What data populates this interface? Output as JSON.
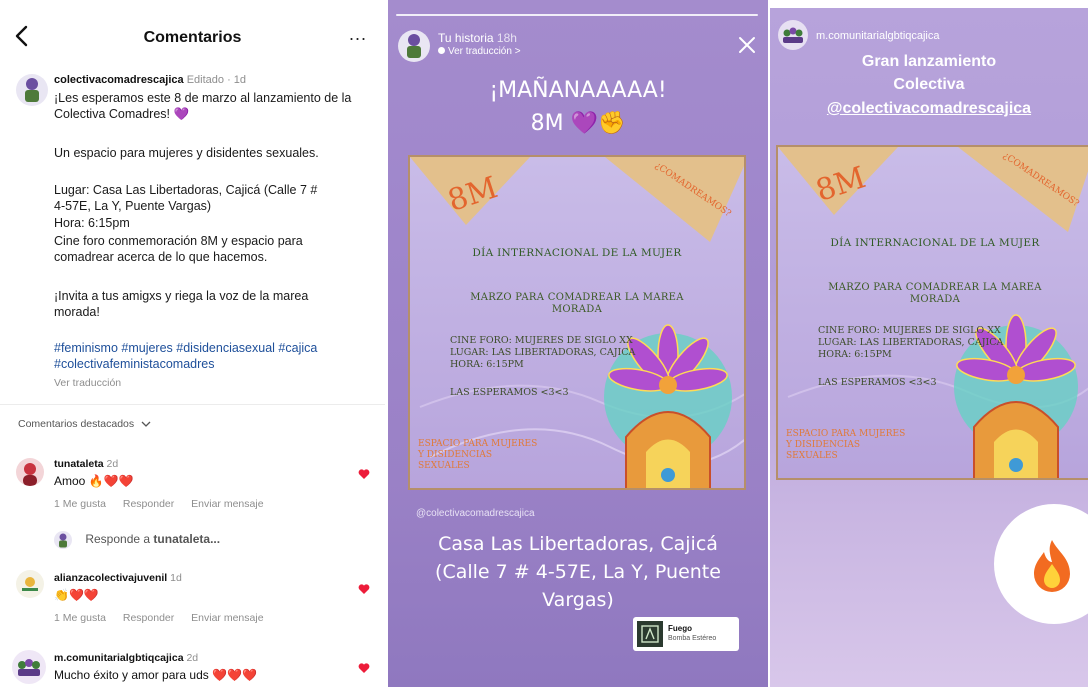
{
  "comments_panel": {
    "title": "Comentarios",
    "more": "...",
    "post": {
      "username": "colectivacomadrescajica",
      "meta": "Editado · 1d",
      "lines": [
        "¡Les esperamos este 8 de marzo al lanzamiento de la",
        "Colectiva Comadres! 💜",
        "Un espacio para mujeres y disidentes sexuales.",
        "Lugar: Casa Las Libertadoras, Cajicá (Calle 7 #",
        "4-57E, La Y, Puente Vargas)",
        "Hora: 6:15pm",
        "Cine foro conmemoración 8M y espacio para",
        "comadrear acerca de lo que hacemos.",
        "¡Invita a tus amigxs y riega la voz de la marea",
        "morada!"
      ],
      "hashtags_1": "#feminismo #mujeres #disidenciasexual #cajica",
      "hashtags_2": "#colectivafeministacomadres",
      "see_translation": "Ver traducción"
    },
    "featured_label": "Comentarios destacados",
    "comments": [
      {
        "username": "tunataleta",
        "meta": "2d",
        "text": "Amoo 🔥❤️❤️",
        "likes": "1 Me gusta",
        "reply": "Responder",
        "message": "Enviar mensaje"
      },
      {
        "username": "alianzacolectivajuvenil",
        "meta": "1d",
        "text": "👏❤️❤️",
        "likes": "1 Me gusta",
        "reply": "Responder",
        "message": "Enviar mensaje"
      },
      {
        "username": "m.comunitarialgbtiqcajica",
        "meta": "2d",
        "text": "Mucho éxito y amor para uds ❤️❤️❤️"
      }
    ],
    "reply_prompt_prefix": "Responde a ",
    "reply_prompt_user": "tunataleta...",
    "colors": {
      "heart": "#ed1c3a",
      "hashtag": "#1e4f9a",
      "meta": "#8e8e8e"
    }
  },
  "story_panel": {
    "username": "Tu historia",
    "time": "18h",
    "translation": "Ver traducción >",
    "headline_1": "¡MAÑANAAAAA!",
    "headline_2": "8M 💜✊",
    "mention": "@colectivacomadrescajica",
    "location_1": "Casa Las Libertadoras, Cajicá",
    "location_2": "(Calle 7 # 4-57E, La Y, Puente",
    "location_3": "Vargas)",
    "music_title": "Fuego",
    "music_artist": "Bomba Estéreo"
  },
  "repost_panel": {
    "username": "m.comunitarialgbtiqcajica",
    "line_1": "Gran lanzamiento",
    "line_2": "Colectiva",
    "line_3": "@colectivacomadrescajica"
  },
  "poster": {
    "flag_left": "8M",
    "flag_right": "¿COMADREAMOS?",
    "title": "DÍA INTERNACIONAL DE LA MUJER",
    "sub_1": "MARZO PARA COMADREAR LA MAREA",
    "sub_2": "MORADA",
    "info_1": "CINE FORO: MUJERES DE SIGLO XX",
    "info_2": "LUGAR: LAS LIBERTADORAS, CAJICA",
    "info_3": "HORA: 6:15PM",
    "info_4": "LAS ESPERAMOS <3<3",
    "space_1": "ESPACIO PARA MUJERES",
    "space_2": "Y DISIDENCIAS",
    "space_3": "SEXUALES"
  }
}
